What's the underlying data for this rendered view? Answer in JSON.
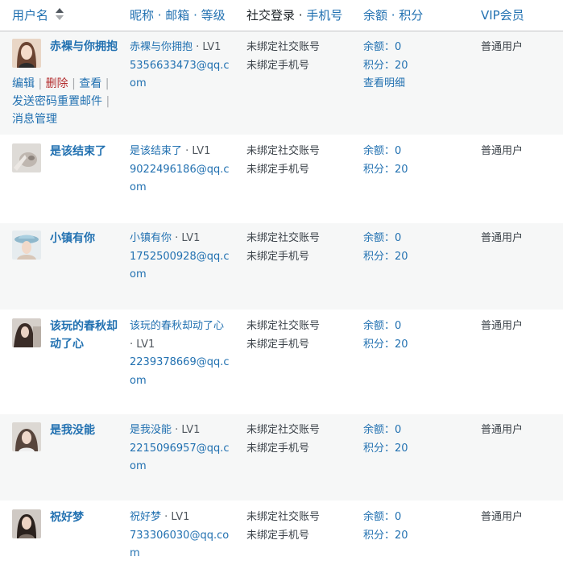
{
  "header": {
    "username": "用户名",
    "nickname_email_level": "昵称 · 邮箱 · 等级",
    "social_login": "社交登录",
    "phone": "手机号",
    "sep": " · ",
    "balance_points": "余额 · 积分",
    "vip": "VIP会员"
  },
  "common": {
    "social_unbound": "未绑定社交账号",
    "phone_unbound": "未绑定手机号",
    "balance_label": "余额：",
    "points_label": "积分：",
    "membership": "普通用户",
    "level_suffix": " · LV1"
  },
  "row_actions": {
    "edit": "编辑",
    "delete": "删除",
    "view": "查看",
    "send_reset": "发送密码重置邮件",
    "messages": "消息管理",
    "view_detail": "查看明细"
  },
  "users": [
    {
      "name": "赤裸与你拥抱",
      "nickname": "赤裸与你拥抱",
      "email": "5356633473@qq.com",
      "balance": "0",
      "points": "20"
    },
    {
      "name": "是该结束了",
      "nickname": "是该结束了",
      "email": "9022496186@qq.com",
      "balance": "0",
      "points": "20"
    },
    {
      "name": "小镇有你",
      "nickname": "小镇有你",
      "email": "1752500928@qq.com",
      "balance": "0",
      "points": "20"
    },
    {
      "name": "该玩的春秋却动了心",
      "nickname": "该玩的春秋却动了心",
      "email": "2239378669@qq.com",
      "balance": "0",
      "points": "20"
    },
    {
      "name": "是我没能",
      "nickname": "是我没能",
      "email": "2215096957@qq.com",
      "balance": "0",
      "points": "20"
    },
    {
      "name": "祝好梦",
      "nickname": "祝好梦",
      "email": "733306030@qq.com",
      "balance": "0",
      "points": "20"
    }
  ]
}
